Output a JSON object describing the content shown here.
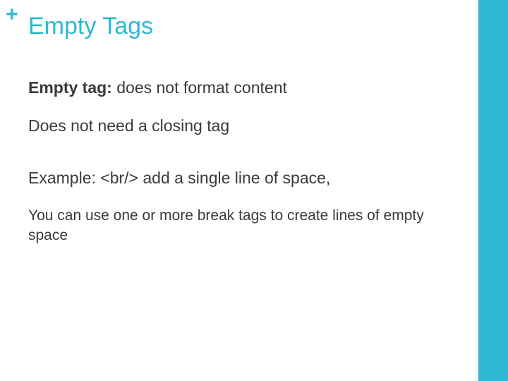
{
  "icon": "+",
  "title": "Empty Tags",
  "body": {
    "p1_bold": "Empty tag:",
    "p1_rest": " does not format content",
    "p2": "Does not need a closing tag",
    "p3": "Example: <br/> add a single line of space,",
    "p4": "You can use one or more break tags to create lines of empty space"
  }
}
